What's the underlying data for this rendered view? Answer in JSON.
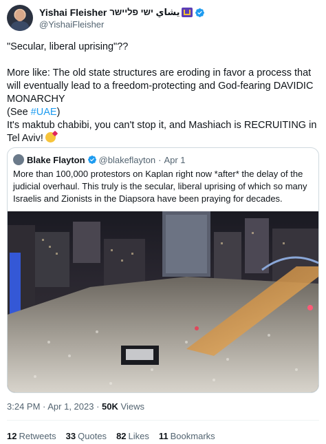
{
  "author": {
    "display_name": "Yishai Fleisher",
    "rtl_name": "يشاي ישי פליישר",
    "handle": "@YishaiFleisher",
    "avatar": "author-avatar",
    "badge_icon": "menorah-emoji-icon",
    "verified_icon": "verified-badge-icon",
    "verified_color": "#1d9bf0"
  },
  "tweet": {
    "paragraph1": "\"Secular, liberal uprising\"??",
    "paragraph2_main": "More like: The old state structures are eroding in favor a process that will eventually lead to a freedom-protecting and God-fearing DAVIDIC MONARCHY",
    "paragraph2_see_open": "(See ",
    "paragraph2_link": "#UAE",
    "paragraph2_see_close": ")",
    "paragraph3": "It's maktub chabibi, you can't stop it, and Mashiach is RECRUITING in Tel Aviv!",
    "emoji": "face-blowing-kiss-icon"
  },
  "quoted": {
    "display_name": "Blake Flayton",
    "handle": "@blakeflayton",
    "separator": "·",
    "date": "Apr 1",
    "text": "More than 100,000 protestors on Kaplan right now *after* the delay of the judicial overhaul. This truly is the secular, liberal uprising of which so many Israelis and Zionists in the Diapsora have been praying for decades.",
    "image": "night-crowd-protest-photo"
  },
  "meta": {
    "time": "3:24 PM",
    "separator1": " · ",
    "date": "Apr 1, 2023",
    "separator2": " · ",
    "views_count": "50K",
    "views_label": " Views"
  },
  "stats": [
    {
      "count": "12",
      "label": "Retweets"
    },
    {
      "count": "33",
      "label": "Quotes"
    },
    {
      "count": "82",
      "label": "Likes"
    },
    {
      "count": "11",
      "label": "Bookmarks"
    }
  ],
  "colors": {
    "link": "#1d9bf0",
    "text": "#0f1419",
    "secondary": "#536471",
    "border": "#cfd9de"
  }
}
